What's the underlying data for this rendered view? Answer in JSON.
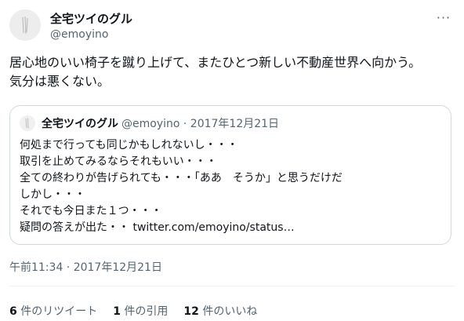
{
  "author": {
    "display_name": "全宅ツイのグル",
    "handle": "@emoyino"
  },
  "more_icon": "more-horizontal-icon",
  "tweet": {
    "lines": [
      "居心地のいい椅子を蹴り上げて、またひとつ新しい不動産世界へ向かう。",
      "気分は悪くない。"
    ]
  },
  "quoted": {
    "display_name": "全宅ツイのグル",
    "meta": "@emoyino · 2017年12月21日",
    "lines": [
      "何処まで行っても同じかもしれないし・・・",
      "取引を止めてみるならそれもいい・・・",
      "全ての終わりが告げられても・・・「ああ　そうか」と思うだけだ",
      "しかし・・・",
      "それでも今日また１つ・・・",
      "疑問の答えが出た・・ twitter.com/emoyino/status…"
    ]
  },
  "timestamp": "午前11:34 · 2017年12月21日",
  "stats": {
    "retweets": {
      "count": "6",
      "label": "件のリツイート"
    },
    "quotes": {
      "count": "1",
      "label": "件の引用"
    },
    "likes": {
      "count": "12",
      "label": "件のいいね"
    }
  }
}
